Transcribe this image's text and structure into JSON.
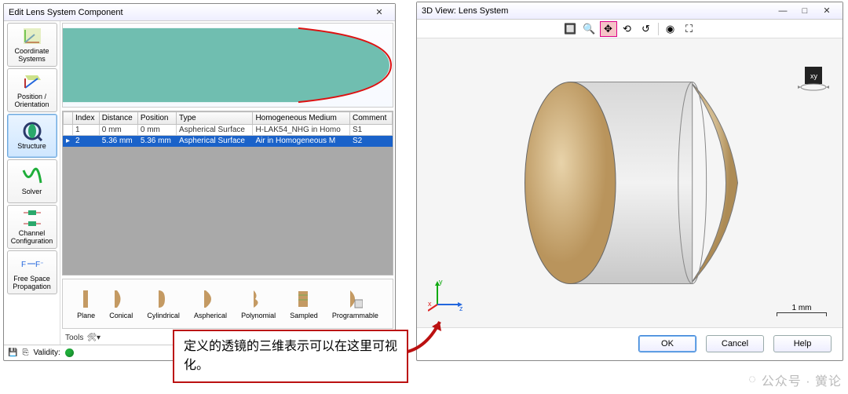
{
  "edit_window": {
    "title": "Edit Lens System Component",
    "close_glyph": "✕",
    "side_tabs": [
      {
        "id": "coordinate-systems",
        "label": "Coordinate Systems"
      },
      {
        "id": "position-orientation",
        "label": "Position / Orientation"
      },
      {
        "id": "structure",
        "label": "Structure",
        "selected": true
      },
      {
        "id": "solver",
        "label": "Solver"
      },
      {
        "id": "channel-configuration",
        "label": "Channel Configuration"
      },
      {
        "id": "free-space-propagation",
        "label": "Free Space Propagation"
      }
    ],
    "grid_headers": [
      "Index",
      "Distance",
      "Position",
      "Type",
      "Homogeneous Medium",
      "Comment"
    ],
    "rows": [
      {
        "index": "1",
        "distance": "0 mm",
        "position": "0 mm",
        "type": "Aspherical Surface",
        "medium": "H-LAK54_NHG in Homo",
        "comment": "S1",
        "selected": false
      },
      {
        "index": "2",
        "distance": "5.36 mm",
        "position": "5.36 mm",
        "type": "Aspherical Surface",
        "medium": "Air in Homogeneous M",
        "comment": "S2",
        "selected": true
      }
    ],
    "shapes": [
      "Plane",
      "Conical",
      "Cylindrical",
      "Aspherical",
      "Polynomial",
      "Sampled",
      "Programmable"
    ],
    "tools_label": "Tools",
    "footer_validity_label": "Validity:"
  },
  "view_window": {
    "title": "3D View: Lens System",
    "tool_icons": [
      "zoom-area",
      "zoom",
      "pan",
      "reset",
      "rotate",
      "sep",
      "camera",
      "fullscreen"
    ],
    "selected_tool": "pan",
    "axis_labels": {
      "x": "x",
      "y": "y",
      "z": "z"
    },
    "scale_label": "1 mm",
    "buttons": {
      "ok": "OK",
      "cancel": "Cancel",
      "help": "Help"
    },
    "min_glyph": "—",
    "max_glyph": "□",
    "close_glyph": "✕"
  },
  "callout_text": "定义的透镜的三维表示可以在这里可视化。",
  "watermark": "公众号 · 黉论"
}
